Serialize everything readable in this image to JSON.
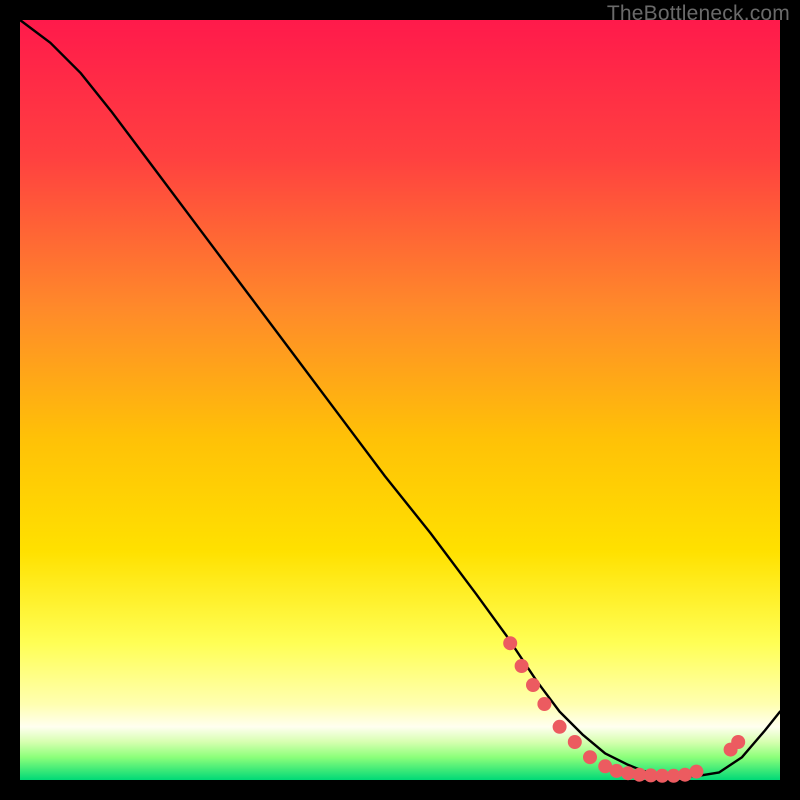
{
  "attribution": "TheBottleneck.com",
  "colors": {
    "top": "#ff1a4b",
    "mid_upper": "#ff7a2a",
    "mid": "#ffd400",
    "mid_lower": "#ffff66",
    "band_pale": "#ffffcc",
    "band_green_light": "#9cff66",
    "band_green": "#00e676",
    "curve": "#000000",
    "dot": "#ec5b60"
  },
  "chart_data": {
    "type": "line",
    "title": "",
    "xlabel": "",
    "ylabel": "",
    "xlim": [
      0,
      100
    ],
    "ylim": [
      0,
      100
    ],
    "annotations": [],
    "series": [
      {
        "name": "curve",
        "x": [
          0,
          4,
          8,
          12,
          18,
          24,
          30,
          36,
          42,
          48,
          54,
          60,
          64,
          68,
          71,
          74,
          77,
          80,
          82,
          84,
          86,
          89,
          92,
          95,
          98,
          100
        ],
        "values": [
          100,
          97,
          93,
          88,
          80,
          72,
          64,
          56,
          48,
          40,
          32.5,
          24.5,
          19,
          13,
          9,
          6,
          3.5,
          2,
          1.2,
          0.7,
          0.5,
          0.5,
          1,
          3,
          6.5,
          9
        ]
      }
    ],
    "markers": [
      {
        "x": 64.5,
        "y": 18.0
      },
      {
        "x": 66.0,
        "y": 15.0
      },
      {
        "x": 67.5,
        "y": 12.5
      },
      {
        "x": 69.0,
        "y": 10.0
      },
      {
        "x": 71.0,
        "y": 7.0
      },
      {
        "x": 73.0,
        "y": 5.0
      },
      {
        "x": 75.0,
        "y": 3.0
      },
      {
        "x": 77.0,
        "y": 1.8
      },
      {
        "x": 78.5,
        "y": 1.2
      },
      {
        "x": 80.0,
        "y": 0.9
      },
      {
        "x": 81.5,
        "y": 0.7
      },
      {
        "x": 83.0,
        "y": 0.6
      },
      {
        "x": 84.5,
        "y": 0.55
      },
      {
        "x": 86.0,
        "y": 0.55
      },
      {
        "x": 87.5,
        "y": 0.7
      },
      {
        "x": 89.0,
        "y": 1.1
      },
      {
        "x": 93.5,
        "y": 4.0
      },
      {
        "x": 94.5,
        "y": 5.0
      }
    ]
  }
}
